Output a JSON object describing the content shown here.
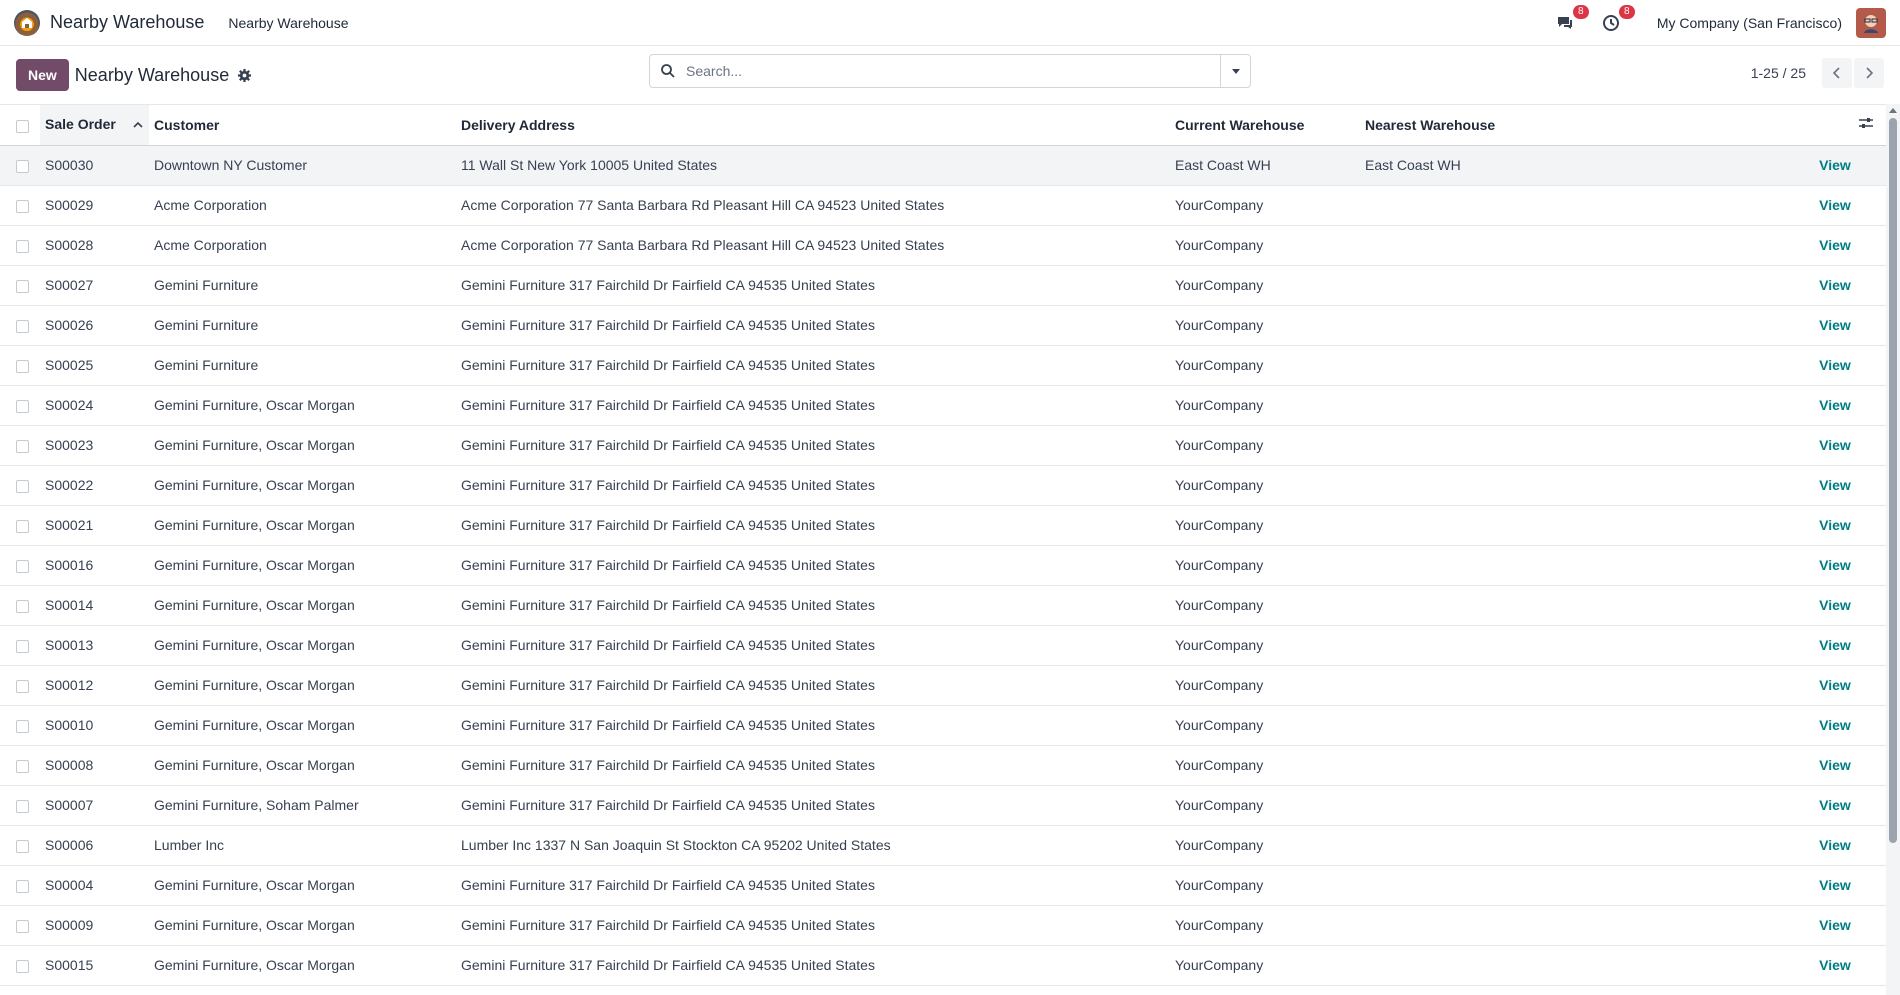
{
  "navbar": {
    "app_name": "Nearby Warehouse",
    "menu_item": "Nearby Warehouse",
    "messages_badge": "8",
    "activities_badge": "8",
    "company": "My Company (San Francisco)"
  },
  "control_panel": {
    "new_label": "New",
    "title": "Nearby Warehouse",
    "search_placeholder": "Search...",
    "pager_value": "1-25 / 25"
  },
  "table": {
    "headers": {
      "sale_order": "Sale Order",
      "customer": "Customer",
      "delivery_address": "Delivery Address",
      "current_warehouse": "Current Warehouse",
      "nearest_warehouse": "Nearest Warehouse"
    },
    "view_label": "View",
    "rows": [
      {
        "order": "S00030",
        "customer": "Downtown NY Customer",
        "address": "11 Wall St New York 10005 United States",
        "current": "East Coast WH",
        "nearest": "East Coast WH"
      },
      {
        "order": "S00029",
        "customer": "Acme Corporation",
        "address": "Acme Corporation 77 Santa Barbara Rd Pleasant Hill CA 94523 United States",
        "current": "YourCompany",
        "nearest": ""
      },
      {
        "order": "S00028",
        "customer": "Acme Corporation",
        "address": "Acme Corporation 77 Santa Barbara Rd Pleasant Hill CA 94523 United States",
        "current": "YourCompany",
        "nearest": ""
      },
      {
        "order": "S00027",
        "customer": "Gemini Furniture",
        "address": "Gemini Furniture 317 Fairchild Dr Fairfield CA 94535 United States",
        "current": "YourCompany",
        "nearest": ""
      },
      {
        "order": "S00026",
        "customer": "Gemini Furniture",
        "address": "Gemini Furniture 317 Fairchild Dr Fairfield CA 94535 United States",
        "current": "YourCompany",
        "nearest": ""
      },
      {
        "order": "S00025",
        "customer": "Gemini Furniture",
        "address": "Gemini Furniture 317 Fairchild Dr Fairfield CA 94535 United States",
        "current": "YourCompany",
        "nearest": ""
      },
      {
        "order": "S00024",
        "customer": "Gemini Furniture, Oscar Morgan",
        "address": "Gemini Furniture 317 Fairchild Dr Fairfield CA 94535 United States",
        "current": "YourCompany",
        "nearest": ""
      },
      {
        "order": "S00023",
        "customer": "Gemini Furniture, Oscar Morgan",
        "address": "Gemini Furniture 317 Fairchild Dr Fairfield CA 94535 United States",
        "current": "YourCompany",
        "nearest": ""
      },
      {
        "order": "S00022",
        "customer": "Gemini Furniture, Oscar Morgan",
        "address": "Gemini Furniture 317 Fairchild Dr Fairfield CA 94535 United States",
        "current": "YourCompany",
        "nearest": ""
      },
      {
        "order": "S00021",
        "customer": "Gemini Furniture, Oscar Morgan",
        "address": "Gemini Furniture 317 Fairchild Dr Fairfield CA 94535 United States",
        "current": "YourCompany",
        "nearest": ""
      },
      {
        "order": "S00016",
        "customer": "Gemini Furniture, Oscar Morgan",
        "address": "Gemini Furniture 317 Fairchild Dr Fairfield CA 94535 United States",
        "current": "YourCompany",
        "nearest": ""
      },
      {
        "order": "S00014",
        "customer": "Gemini Furniture, Oscar Morgan",
        "address": "Gemini Furniture 317 Fairchild Dr Fairfield CA 94535 United States",
        "current": "YourCompany",
        "nearest": ""
      },
      {
        "order": "S00013",
        "customer": "Gemini Furniture, Oscar Morgan",
        "address": "Gemini Furniture 317 Fairchild Dr Fairfield CA 94535 United States",
        "current": "YourCompany",
        "nearest": ""
      },
      {
        "order": "S00012",
        "customer": "Gemini Furniture, Oscar Morgan",
        "address": "Gemini Furniture 317 Fairchild Dr Fairfield CA 94535 United States",
        "current": "YourCompany",
        "nearest": ""
      },
      {
        "order": "S00010",
        "customer": "Gemini Furniture, Oscar Morgan",
        "address": "Gemini Furniture 317 Fairchild Dr Fairfield CA 94535 United States",
        "current": "YourCompany",
        "nearest": ""
      },
      {
        "order": "S00008",
        "customer": "Gemini Furniture, Oscar Morgan",
        "address": "Gemini Furniture 317 Fairchild Dr Fairfield CA 94535 United States",
        "current": "YourCompany",
        "nearest": ""
      },
      {
        "order": "S00007",
        "customer": "Gemini Furniture, Soham Palmer",
        "address": "Gemini Furniture 317 Fairchild Dr Fairfield CA 94535 United States",
        "current": "YourCompany",
        "nearest": ""
      },
      {
        "order": "S00006",
        "customer": "Lumber Inc",
        "address": "Lumber Inc 1337 N San Joaquin St Stockton CA 95202 United States",
        "current": "YourCompany",
        "nearest": ""
      },
      {
        "order": "S00004",
        "customer": "Gemini Furniture, Oscar Morgan",
        "address": "Gemini Furniture 317 Fairchild Dr Fairfield CA 94535 United States",
        "current": "YourCompany",
        "nearest": ""
      },
      {
        "order": "S00009",
        "customer": "Gemini Furniture, Oscar Morgan",
        "address": "Gemini Furniture 317 Fairchild Dr Fairfield CA 94535 United States",
        "current": "YourCompany",
        "nearest": ""
      },
      {
        "order": "S00015",
        "customer": "Gemini Furniture, Oscar Morgan",
        "address": "Gemini Furniture 317 Fairchild Dr Fairfield CA 94535 United States",
        "current": "YourCompany",
        "nearest": ""
      }
    ]
  }
}
